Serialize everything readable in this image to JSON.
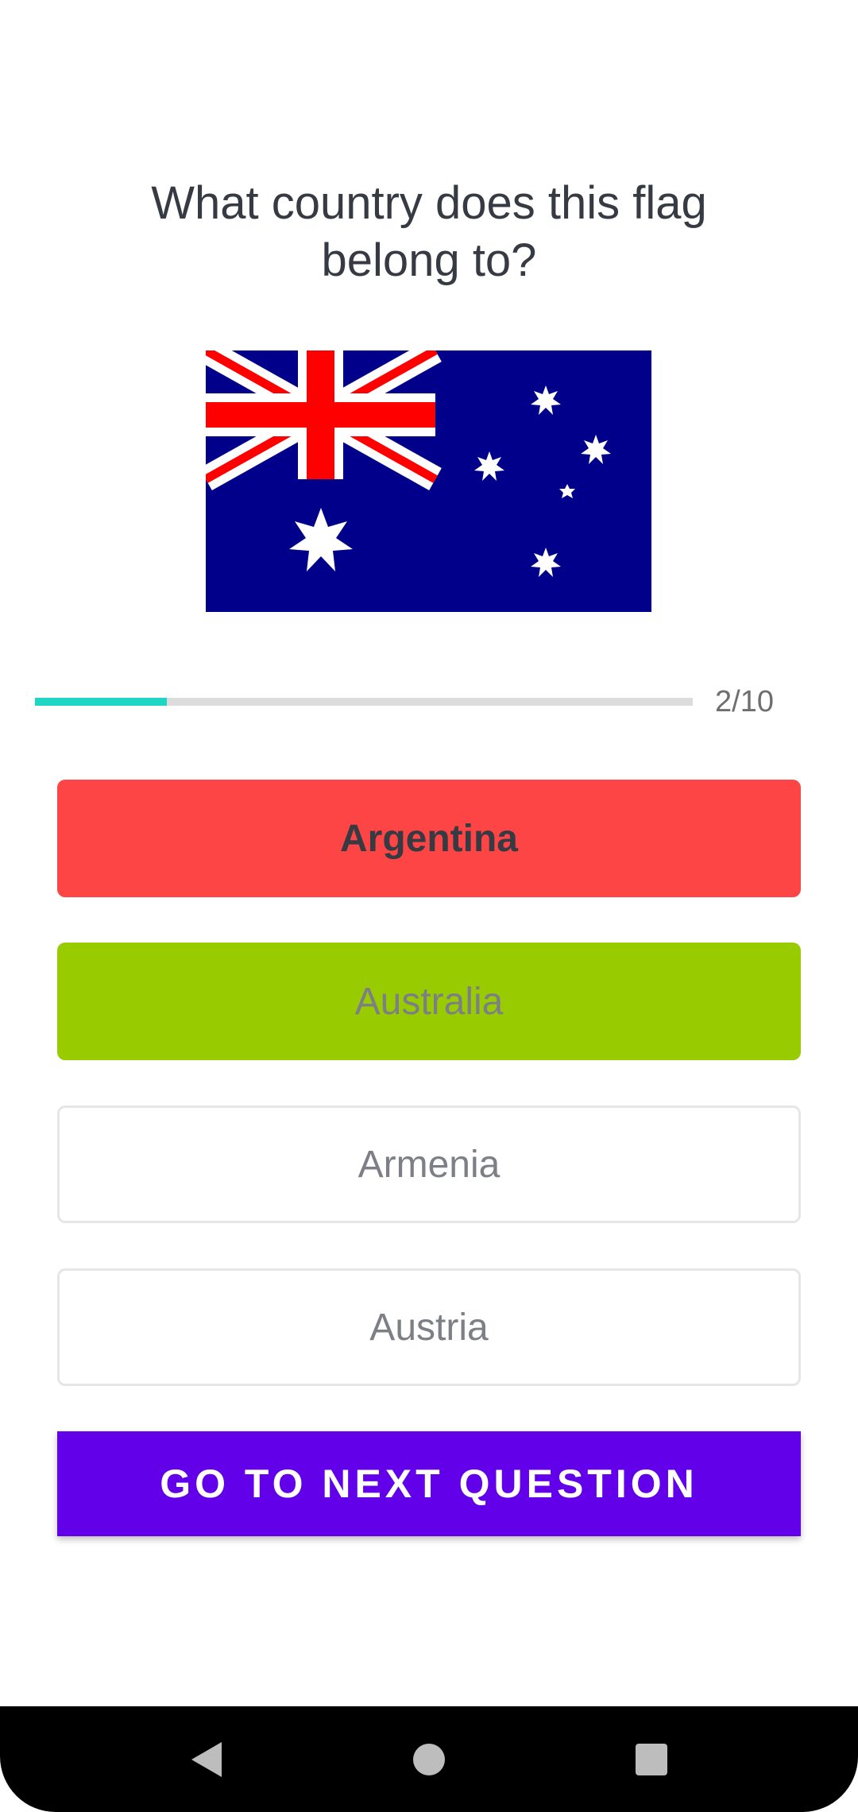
{
  "question": {
    "text": "What country does this flag belong to?"
  },
  "flag": {
    "icon": "australia-flag-icon",
    "colors": {
      "field": "#00008b",
      "red": "#ff0000",
      "white": "#ffffff"
    }
  },
  "progress": {
    "current": 2,
    "total": 10,
    "label": "2/10",
    "fraction": 0.2,
    "color": "#1fd6c4"
  },
  "answers": [
    {
      "label": "Argentina",
      "state": "wrong",
      "color": "#fe4545"
    },
    {
      "label": "Australia",
      "state": "correct",
      "color": "#98cc00"
    },
    {
      "label": "Armenia",
      "state": "neutral"
    },
    {
      "label": "Austria",
      "state": "neutral"
    }
  ],
  "next_button": {
    "label": "GO TO NEXT QUESTION",
    "color": "#6200ea"
  },
  "nav_bar": {
    "back_icon": "back-triangle-icon",
    "home_icon": "home-circle-icon",
    "recents_icon": "recents-square-icon"
  }
}
